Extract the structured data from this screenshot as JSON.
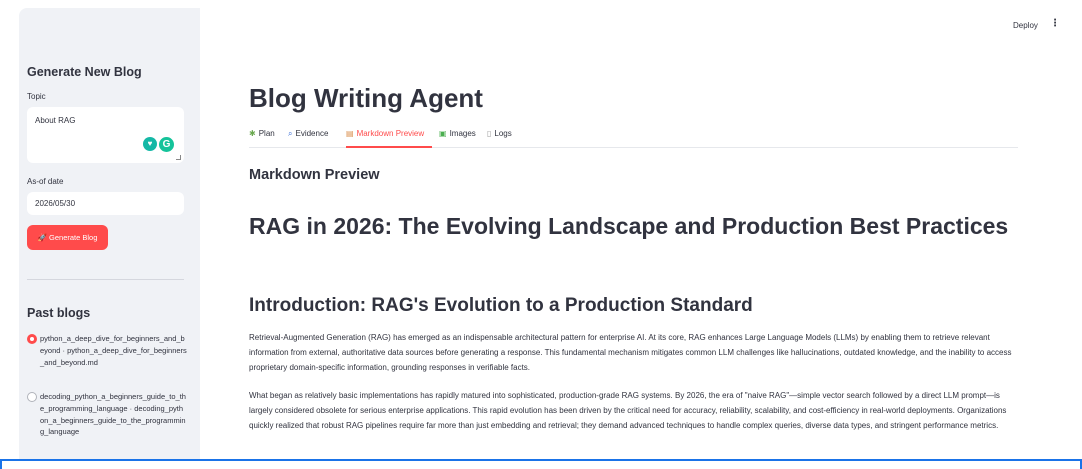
{
  "sidebar": {
    "heading": "Generate New Blog",
    "topic_label": "Topic",
    "topic_value": "About RAG",
    "date_label": "As-of date",
    "date_value": "2026/05/30",
    "generate_button": "Generate Blog",
    "generate_icon": "rocket-icon",
    "past_heading": "Past blogs",
    "past_blogs": [
      {
        "label": "python_a_deep_dive_for_beginners_and_beyond · python_a_deep_dive_for_beginners_and_beyond.md",
        "selected": true
      },
      {
        "label": "decoding_python_a_beginners_guide_to_the_programming_language · decoding_python_a_beginners_guide_to_the_programming_language",
        "selected": false
      }
    ]
  },
  "header": {
    "deploy_label": "Deploy",
    "menu_icon": "kebab-menu-icon"
  },
  "main": {
    "title": "Blog Writing Agent",
    "tabs": [
      {
        "label": "Plan",
        "icon": "puzzle-icon"
      },
      {
        "label": "Evidence",
        "icon": "magnifier-icon"
      },
      {
        "label": "Markdown Preview",
        "icon": "memo-icon",
        "active": true
      },
      {
        "label": "Images",
        "icon": "picture-icon"
      },
      {
        "label": "Logs",
        "icon": "scroll-icon"
      }
    ],
    "section_heading": "Markdown Preview",
    "doc_title": "RAG in 2026: The Evolving Landscape and Production Best Practices",
    "doc_h2": "Introduction: RAG's Evolution to a Production Standard",
    "paragraphs": [
      "Retrieval-Augmented Generation (RAG) has emerged as an indispensable architectural pattern for enterprise AI. At its core, RAG enhances Large Language Models (LLMs) by enabling them to retrieve relevant information from external, authoritative data sources before generating a response. This fundamental mechanism mitigates common LLM challenges like hallucinations, outdated knowledge, and the inability to access proprietary domain-specific information, grounding responses in verifiable facts.",
      "What began as relatively basic implementations has rapidly matured into sophisticated, production-grade RAG systems. By 2026, the era of \"naive RAG\"—simple vector search followed by a direct LLM prompt—is largely considered obsolete for serious enterprise applications. This rapid evolution has been driven by the critical need for accuracy, reliability, scalability, and cost-efficiency in real-world deployments. Organizations quickly realized that robust RAG pipelines require far more than just embedding and retrieval; they demand advanced techniques to handle complex queries, diverse data types, and stringent performance metrics."
    ]
  },
  "colors": {
    "accent": "#ff4b4b",
    "sidebar_bg": "#f0f2f6",
    "text": "#31333f"
  }
}
